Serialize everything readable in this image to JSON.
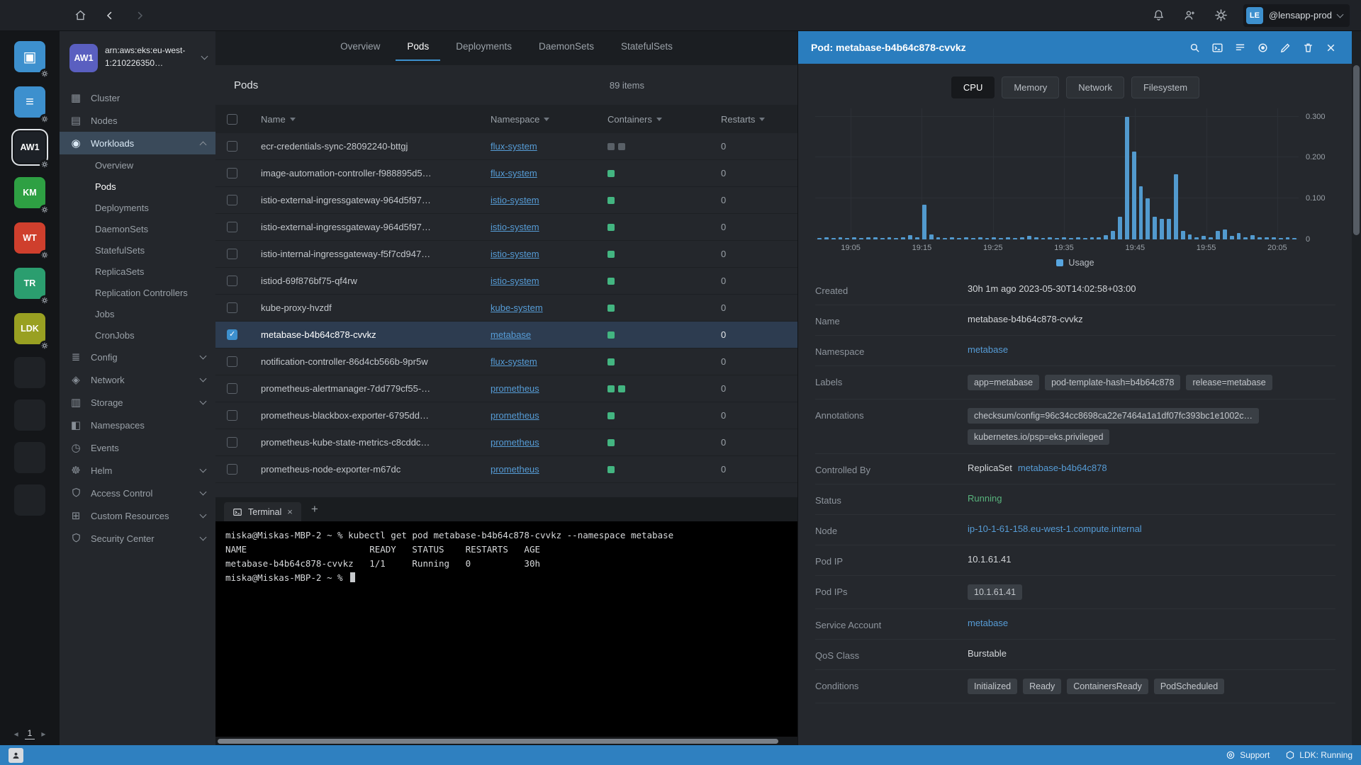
{
  "colors": {
    "accent_blue": "#3d90ce",
    "panel_header_blue": "#2a7dbe",
    "link_blue": "#569cd6",
    "running_green": "#58b37c",
    "container_green": "#43b581"
  },
  "topbar": {
    "account": {
      "initials": "LE",
      "name": "@lensapp-prod"
    }
  },
  "hotbar": {
    "items": [
      {
        "name": "catalog",
        "glyph": "▣",
        "color": "#3d90ce"
      },
      {
        "name": "catalog-list",
        "glyph": "≡",
        "color": "#3d90ce"
      },
      {
        "name": "cluster-aw1",
        "label": "AW1",
        "color": "#1d2127",
        "active": true
      },
      {
        "name": "cluster-km",
        "label": "KM",
        "color": "#2ea043"
      },
      {
        "name": "cluster-wt",
        "label": "WT",
        "color": "#cf3f2d"
      },
      {
        "name": "cluster-tr",
        "label": "TR",
        "color": "#2b9e6f"
      },
      {
        "name": "cluster-ldk",
        "label": "LDK",
        "color": "#99a022"
      }
    ],
    "empty_slots": 4,
    "page": "1"
  },
  "sidebar": {
    "cluster_badge": "AW1",
    "cluster_name": "arn:aws:eks:eu-west-1:210226350…",
    "items": [
      {
        "label": "Cluster",
        "icon": "cluster-icon",
        "glyph": "▦"
      },
      {
        "label": "Nodes",
        "icon": "nodes-icon",
        "glyph": "▤"
      },
      {
        "label": "Workloads",
        "icon": "workloads-icon",
        "glyph": "◉",
        "expanded": true,
        "active": true,
        "children": [
          "Overview",
          "Pods",
          "Deployments",
          "DaemonSets",
          "StatefulSets",
          "ReplicaSets",
          "Replication Controllers",
          "Jobs",
          "CronJobs"
        ],
        "active_child": "Pods"
      },
      {
        "label": "Config",
        "icon": "config-icon",
        "glyph": "≣",
        "expandable": true
      },
      {
        "label": "Network",
        "icon": "network-icon",
        "glyph": "◈",
        "expandable": true
      },
      {
        "label": "Storage",
        "icon": "storage-icon",
        "glyph": "▥",
        "expandable": true
      },
      {
        "label": "Namespaces",
        "icon": "namespaces-icon",
        "glyph": "◧"
      },
      {
        "label": "Events",
        "icon": "events-icon",
        "glyph": "◷"
      },
      {
        "label": "Helm",
        "icon": "helm-icon",
        "glyph": "☸",
        "expandable": true
      },
      {
        "label": "Access Control",
        "icon": "access-control-icon",
        "svg": "shield",
        "expandable": true
      },
      {
        "label": "Custom Resources",
        "icon": "custom-resources-icon",
        "glyph": "⊞",
        "expandable": true
      },
      {
        "label": "Security Center",
        "icon": "security-center-icon",
        "svg": "shield",
        "expandable": true
      }
    ]
  },
  "main": {
    "tabs": [
      "Overview",
      "Pods",
      "Deployments",
      "DaemonSets",
      "StatefulSets"
    ],
    "active_tab": "Pods"
  },
  "pods": {
    "title": "Pods",
    "count": "89 items",
    "columns": [
      "Name",
      "Namespace",
      "Containers",
      "Restarts"
    ],
    "rows": [
      {
        "name": "ecr-credentials-sync-28092240-bttgj",
        "namespace": "flux-system",
        "containers": [
          "gray",
          "gray"
        ],
        "restarts": "0"
      },
      {
        "name": "image-automation-controller-f988895d5…",
        "namespace": "flux-system",
        "containers": [
          "green"
        ],
        "restarts": "0"
      },
      {
        "name": "istio-external-ingressgateway-964d5f97…",
        "namespace": "istio-system",
        "containers": [
          "green"
        ],
        "restarts": "0"
      },
      {
        "name": "istio-external-ingressgateway-964d5f97…",
        "namespace": "istio-system",
        "containers": [
          "green"
        ],
        "restarts": "0"
      },
      {
        "name": "istio-internal-ingressgateway-f5f7cd947…",
        "namespace": "istio-system",
        "containers": [
          "green"
        ],
        "restarts": "0"
      },
      {
        "name": "istiod-69f876bf75-qf4rw",
        "namespace": "istio-system",
        "containers": [
          "green"
        ],
        "restarts": "0"
      },
      {
        "name": "kube-proxy-hvzdf",
        "namespace": "kube-system",
        "containers": [
          "green"
        ],
        "restarts": "0"
      },
      {
        "name": "metabase-b4b64c878-cvvkz",
        "namespace": "metabase",
        "containers": [
          "green"
        ],
        "restarts": "0",
        "selected": true
      },
      {
        "name": "notification-controller-86d4cb566b-9pr5w",
        "namespace": "flux-system",
        "containers": [
          "green"
        ],
        "restarts": "0"
      },
      {
        "name": "prometheus-alertmanager-7dd779cf55-…",
        "namespace": "prometheus",
        "containers": [
          "green",
          "green"
        ],
        "restarts": "0"
      },
      {
        "name": "prometheus-blackbox-exporter-6795dd…",
        "namespace": "prometheus",
        "containers": [
          "green"
        ],
        "restarts": "0"
      },
      {
        "name": "prometheus-kube-state-metrics-c8cddc…",
        "namespace": "prometheus",
        "containers": [
          "green"
        ],
        "restarts": "0"
      },
      {
        "name": "prometheus-node-exporter-m67dc",
        "namespace": "prometheus",
        "containers": [
          "green"
        ],
        "restarts": "0"
      }
    ]
  },
  "terminal": {
    "tab": "Terminal",
    "lines": [
      "miska@Miskas-MBP-2 ~ % kubectl get pod metabase-b4b64c878-cvvkz --namespace metabase",
      "NAME                       READY   STATUS    RESTARTS   AGE",
      "metabase-b4b64c878-cvvkz   1/1     Running   0          30h",
      "miska@Miskas-MBP-2 ~ % "
    ]
  },
  "detail": {
    "title": "Pod: metabase-b4b64c878-cvvkz",
    "tabs": [
      "CPU",
      "Memory",
      "Network",
      "Filesystem"
    ],
    "active_tab": "CPU",
    "rows": [
      {
        "label": "Created",
        "type": "text",
        "value": "30h 1m ago 2023-05-30T14:02:58+03:00"
      },
      {
        "label": "Name",
        "type": "text",
        "value": "metabase-b4b64c878-cvvkz"
      },
      {
        "label": "Namespace",
        "type": "link",
        "value": "metabase"
      },
      {
        "label": "Labels",
        "type": "badges",
        "values": [
          "app=metabase",
          "pod-template-hash=b4b64c878",
          "release=metabase"
        ]
      },
      {
        "label": "Annotations",
        "type": "badges",
        "values": [
          "checksum/config=96c34cc8698ca22e7464a1a1df07fc393bc1e1002c…",
          "kubernetes.io/psp=eks.privileged"
        ]
      },
      {
        "label": "Controlled By",
        "type": "link_prefixed",
        "prefix": "ReplicaSet",
        "link": "metabase-b4b64c878"
      },
      {
        "label": "Status",
        "type": "status",
        "value": "Running"
      },
      {
        "label": "Node",
        "type": "link",
        "value": "ip-10-1-61-158.eu-west-1.compute.internal"
      },
      {
        "label": "Pod IP",
        "type": "text",
        "value": "10.1.61.41"
      },
      {
        "label": "Pod IPs",
        "type": "badges",
        "values": [
          "10.1.61.41"
        ]
      },
      {
        "label": "Service Account",
        "type": "link",
        "value": "metabase"
      },
      {
        "label": "QoS Class",
        "type": "text",
        "value": "Burstable"
      },
      {
        "label": "Conditions",
        "type": "badges",
        "values": [
          "Initialized",
          "Ready",
          "ContainersReady",
          "PodScheduled"
        ]
      }
    ]
  },
  "chart_data": {
    "type": "bar",
    "title": "",
    "xlabel": "",
    "ylabel": "",
    "ylim": [
      0,
      0.32
    ],
    "legend_label": "Usage",
    "legend_position": "bottom-center",
    "grid": true,
    "y_ticks": [
      {
        "label": "0.300",
        "value": 0.3
      },
      {
        "label": "0.200",
        "value": 0.2
      },
      {
        "label": "0.100",
        "value": 0.1
      },
      {
        "label": "0",
        "value": 0
      }
    ],
    "x_ticks": [
      {
        "label": "19:05",
        "position": 5
      },
      {
        "label": "19:15",
        "position": 15
      },
      {
        "label": "19:25",
        "position": 25
      },
      {
        "label": "19:35",
        "position": 35
      },
      {
        "label": "19:45",
        "position": 45
      },
      {
        "label": "19:55",
        "position": 55
      },
      {
        "label": "20:05",
        "position": 65
      }
    ],
    "series": [
      {
        "name": "Usage",
        "color": "#58a6e0",
        "values": [
          0.004,
          0.005,
          0.004,
          0.006,
          0.004,
          0.005,
          0.004,
          0.005,
          0.006,
          0.004,
          0.005,
          0.004,
          0.006,
          0.01,
          0.005,
          0.085,
          0.012,
          0.005,
          0.004,
          0.005,
          0.004,
          0.005,
          0.004,
          0.006,
          0.004,
          0.005,
          0.004,
          0.005,
          0.004,
          0.006,
          0.008,
          0.005,
          0.004,
          0.005,
          0.004,
          0.006,
          0.004,
          0.005,
          0.004,
          0.006,
          0.006,
          0.01,
          0.02,
          0.055,
          0.3,
          0.215,
          0.13,
          0.1,
          0.055,
          0.05,
          0.05,
          0.16,
          0.02,
          0.012,
          0.006,
          0.008,
          0.006,
          0.02,
          0.025,
          0.008,
          0.015,
          0.006,
          0.01,
          0.005,
          0.006,
          0.005,
          0.004,
          0.005,
          0.004
        ]
      }
    ]
  },
  "statusbar": {
    "support": "Support",
    "cluster_status": "LDK: Running"
  }
}
